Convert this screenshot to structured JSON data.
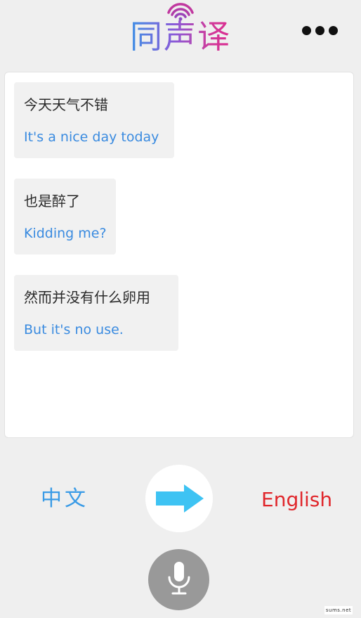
{
  "header": {
    "logo_text": "同声译",
    "logo_gradient": [
      "#2f9be8",
      "#8a5ad8",
      "#e0248a"
    ],
    "more_icon": "more-dots-icon"
  },
  "conversation": [
    {
      "source": "今天天气不错",
      "translation": "It's a nice day today"
    },
    {
      "source": "也是醉了",
      "translation": "Kidding me?"
    },
    {
      "source": "然而并没有什么卵用",
      "translation": "But it's no use."
    }
  ],
  "language_bar": {
    "source_lang": "中文",
    "target_lang": "English",
    "source_color": "#3a9be6",
    "target_color": "#e0262b",
    "swap_icon": "arrow-right-icon",
    "arrow_color": "#3ec3f3"
  },
  "mic": {
    "icon": "microphone-icon",
    "color": "#999999"
  },
  "watermark": "sums.net"
}
